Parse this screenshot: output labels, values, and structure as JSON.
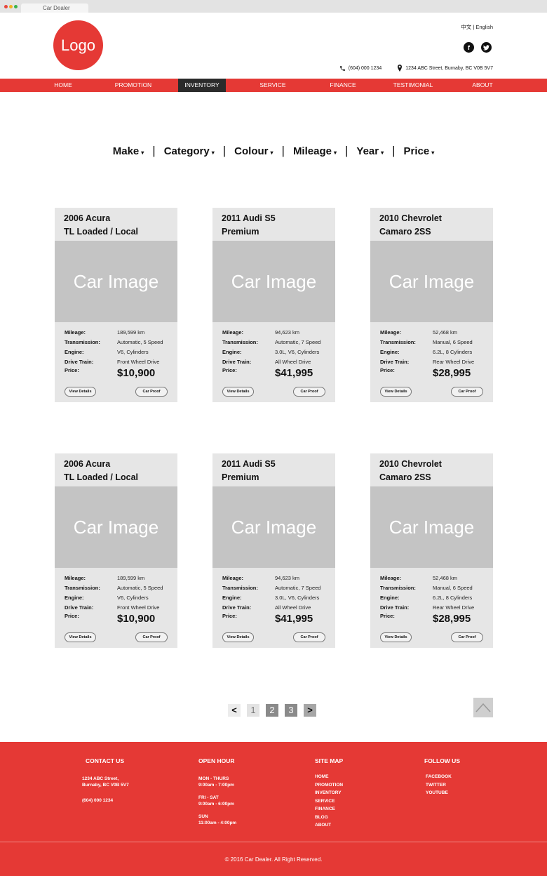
{
  "browser": {
    "tab_title": "Car Dealer"
  },
  "header": {
    "logo": "Logo",
    "lang_cn": "中文",
    "lang_sep": "|",
    "lang_en": "English",
    "phone": "(604) 000 1234",
    "address": "1234 ABC Street, Burnaby, BC  V0B 5V7"
  },
  "nav": {
    "items": [
      "HOME",
      "PROMOTION",
      "INVENTORY",
      "SERVICE",
      "FINANCE",
      "TESTIMONIAL",
      "ABOUT"
    ],
    "active": "INVENTORY"
  },
  "filters": {
    "labels": [
      "Make",
      "Category",
      "Colour",
      "Mileage",
      "Year",
      "Price"
    ],
    "caret": "▾",
    "separator": "|"
  },
  "spec_labels": {
    "mileage": "Mileage:",
    "transmission": "Transmission:",
    "engine": "Engine:",
    "drive_train": "Drive Train:",
    "price": "Price:"
  },
  "buttons": {
    "details": "View Details",
    "proof": "Car Proof"
  },
  "image_placeholder": "Car Image",
  "cars": [
    {
      "title1": "2006 Acura",
      "title2": "TL Loaded / Local",
      "mileage": "189,599 km",
      "transmission": "Automatic, 5 Speed",
      "engine": "V6, Cylinders",
      "drive_train": "Front Wheel Drive",
      "price": "$10,900"
    },
    {
      "title1": "2011 Audi S5",
      "title2": "Premium",
      "mileage": "94,623 km",
      "transmission": "Automatic, 7 Speed",
      "engine": "3.0L, V6, Cylinders",
      "drive_train": "All Wheel Drive",
      "price": "$41,995"
    },
    {
      "title1": "2010 Chevrolet",
      "title2": "Camaro 2SS",
      "mileage": "52,468 km",
      "transmission": "Manual, 6 Speed",
      "engine": "6.2L, 8 Cylinders",
      "drive_train": "Rear Wheel Drive",
      "price": "$28,995"
    },
    {
      "title1": "2006 Acura",
      "title2": "TL Loaded / Local",
      "mileage": "189,599 km",
      "transmission": "Automatic, 5 Speed",
      "engine": "V6, Cylinders",
      "drive_train": "Front Wheel Drive",
      "price": "$10,900"
    },
    {
      "title1": "2011 Audi S5",
      "title2": "Premium",
      "mileage": "94,623 km",
      "transmission": "Automatic, 7 Speed",
      "engine": "3.0L, V6, Cylinders",
      "drive_train": "All Wheel Drive",
      "price": "$41,995"
    },
    {
      "title1": "2010 Chevrolet",
      "title2": "Camaro 2SS",
      "mileage": "52,468 km",
      "transmission": "Manual, 6 Speed",
      "engine": "6.2L, 8 Cylinders",
      "drive_train": "Rear Wheel Drive",
      "price": "$28,995"
    }
  ],
  "pagination": {
    "prev": "<",
    "pages": [
      "1",
      "2",
      "3"
    ],
    "next": ">"
  },
  "footer": {
    "contact": {
      "heading": "CONTACT US",
      "address1": "1234 ABC Street,",
      "address2": "Burnaby, BC  V0B 5V7",
      "phone": "(604) 000 1234"
    },
    "hours": {
      "heading": "OPEN HOUR",
      "d1": "MON - THURS",
      "t1": "9:00am - 7:00pm",
      "d2": "FRI - SAT",
      "t2": "9:00am - 6:00pm",
      "d3": "SUN",
      "t3": "11:00am - 4:00pm"
    },
    "sitemap": {
      "heading": "SITE MAP",
      "links": [
        "HOME",
        "PROMOTION",
        "INVENTORY",
        "SERVICE",
        "FINANCE",
        "BLOG",
        "ABOUT"
      ]
    },
    "follow": {
      "heading": "FOLLOW US",
      "links": [
        "FACEBOOK",
        "TWITTER",
        "YOUTUBE"
      ]
    },
    "copyright": "© 2016 Car Dealer. All Right Reserved."
  },
  "colors": {
    "brand": "#e53935",
    "nav_active": "#2b2b2b",
    "card_bg": "#e6e6e6",
    "image_bg": "#c4c4c4"
  }
}
